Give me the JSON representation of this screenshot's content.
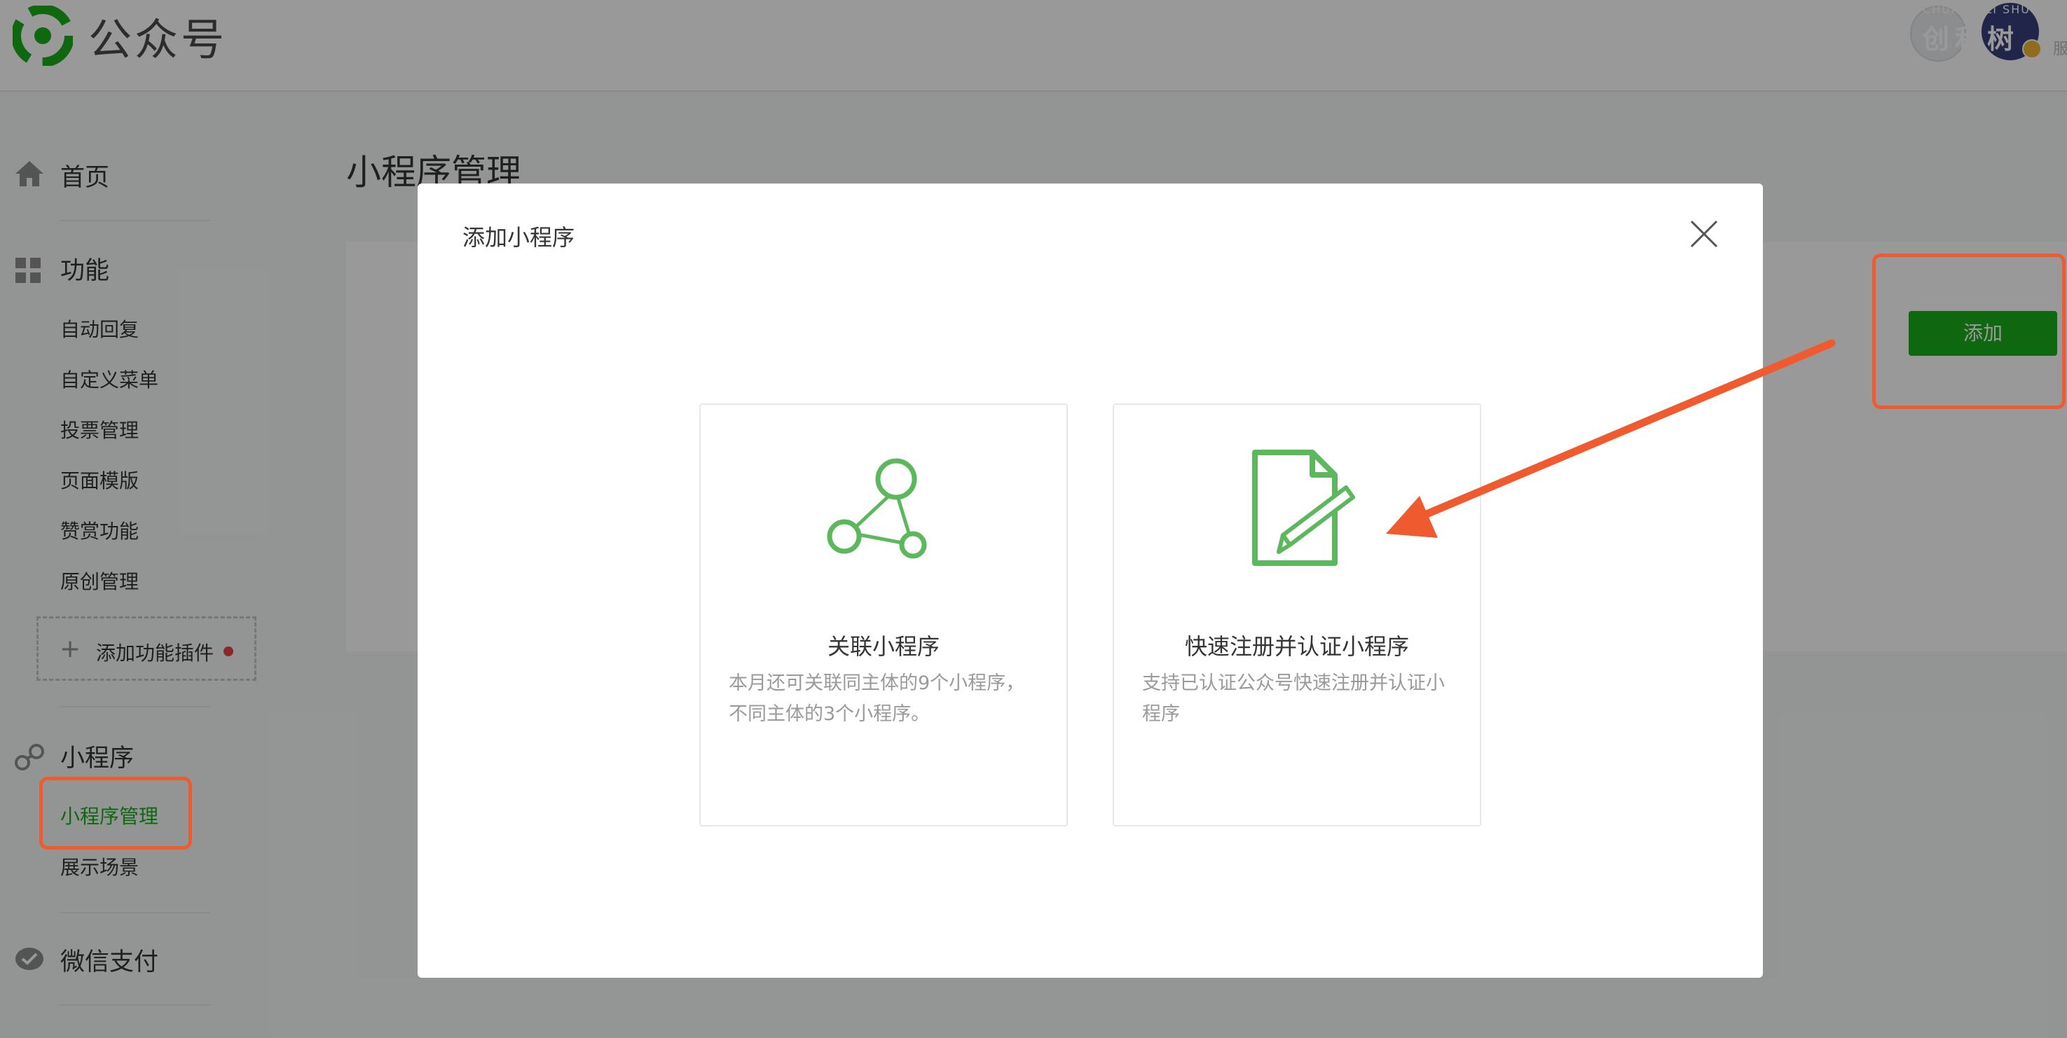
{
  "header": {
    "brand_name": "公众号",
    "account_watermark_small": "CHUANG LI SHU",
    "account_watermark_big": "创利树",
    "account_side_text": "服"
  },
  "sidebar": {
    "home": "首页",
    "features": {
      "title": "功能",
      "items": [
        "自动回复",
        "自定义菜单",
        "投票管理",
        "页面模版",
        "赞赏功能",
        "原创管理"
      ],
      "add_plugin": "添加功能插件"
    },
    "miniprogram": {
      "title": "小程序",
      "items": [
        "小程序管理",
        "展示场景"
      ],
      "active_item": "小程序管理"
    },
    "wechat_pay": "微信支付"
  },
  "main": {
    "page_title": "小程序管理",
    "add_button": "添加"
  },
  "dialog": {
    "title": "添加小程序",
    "options": [
      {
        "title": "关联小程序",
        "description": "本月还可关联同主体的9个小程序，不同主体的3个小程序。"
      },
      {
        "title": "快速注册并认证小程序",
        "description": "支持已认证公众号快速注册并认证小程序"
      }
    ]
  },
  "colors": {
    "brand_green": "#1aad19",
    "icon_green": "#5cb85c",
    "annotation_red": "#ef5b2e",
    "overlay": "rgba(0,0,0,0.4)"
  }
}
